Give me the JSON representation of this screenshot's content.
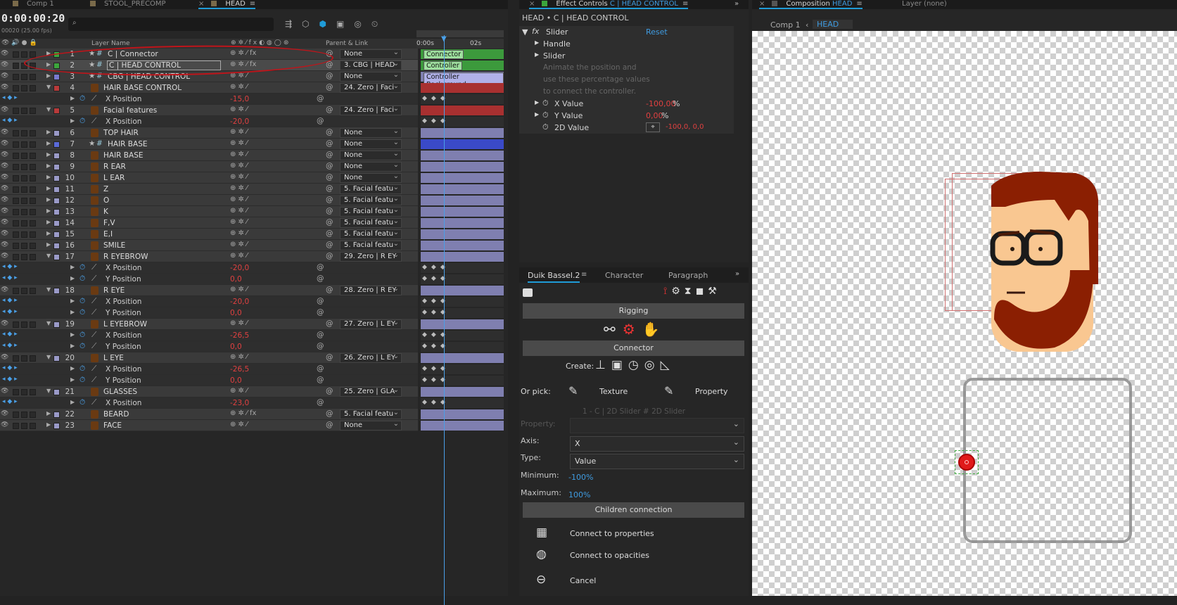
{
  "tabs_left": [
    {
      "label": "Comp 1"
    },
    {
      "label": "STOOL_PRECOMP"
    },
    {
      "label": "HEAD"
    }
  ],
  "tabs_mid": [
    {
      "label": "Effect Controls"
    },
    {
      "label": "C | HEAD CONTROL"
    }
  ],
  "tabs_right": [
    {
      "label": "Composition"
    },
    {
      "label": "HEAD"
    },
    {
      "label": "Layer (none)"
    }
  ],
  "timeline": {
    "timecode": "0:00:00:20",
    "fps": "00020 (25.00 fps)",
    "col_layer_name": "Layer Name",
    "col_parent": "Parent & Link",
    "ruler": [
      "0:00s",
      "02s"
    ],
    "bar_labels": [
      "Connector",
      "Controller",
      "Controller Background"
    ],
    "rows": [
      {
        "t": "layer",
        "num": "1",
        "name": "C | Connector",
        "parent": "None",
        "color": "#3ca63c",
        "star": true,
        "fx": true
      },
      {
        "t": "layer",
        "num": "2",
        "name": "C | HEAD CONTROL",
        "parent": "3. CBG | HEAD",
        "color": "#3ca63c",
        "star": true,
        "fx": true,
        "sel": true
      },
      {
        "t": "layer",
        "num": "3",
        "name": "CBG | HEAD CONTROL",
        "parent": "None",
        "color": "#7a7ad0",
        "star": true
      },
      {
        "t": "layer",
        "num": "4",
        "name": "HAIR BASE CONTROL",
        "parent": "24. Zero | Faci",
        "color": "#b83a3a",
        "open": true
      },
      {
        "t": "prop",
        "name": "X Position",
        "value": "-15,0"
      },
      {
        "t": "layer",
        "num": "5",
        "name": "Facial features",
        "parent": "24. Zero | Faci",
        "color": "#b83a3a",
        "open": true
      },
      {
        "t": "prop",
        "name": "X Position",
        "value": "-20,0"
      },
      {
        "t": "layer",
        "num": "6",
        "name": "TOP HAIR",
        "parent": "None",
        "color": "#9a9ac8"
      },
      {
        "t": "layer",
        "num": "7",
        "name": "HAIR BASE",
        "parent": "None",
        "color": "#5a6ad8",
        "star": true
      },
      {
        "t": "layer",
        "num": "8",
        "name": "HAIR BASE",
        "parent": "None",
        "color": "#9a9ac8"
      },
      {
        "t": "layer",
        "num": "9",
        "name": "R EAR",
        "parent": "None",
        "color": "#9a9ac8"
      },
      {
        "t": "layer",
        "num": "10",
        "name": "L EAR",
        "parent": "None",
        "color": "#9a9ac8"
      },
      {
        "t": "layer",
        "num": "11",
        "name": "Z",
        "parent": "5. Facial featu",
        "color": "#9a9ac8"
      },
      {
        "t": "layer",
        "num": "12",
        "name": "O",
        "parent": "5. Facial featu",
        "color": "#9a9ac8"
      },
      {
        "t": "layer",
        "num": "13",
        "name": "K",
        "parent": "5. Facial featu",
        "color": "#9a9ac8"
      },
      {
        "t": "layer",
        "num": "14",
        "name": "F,V",
        "parent": "5. Facial featu",
        "color": "#9a9ac8"
      },
      {
        "t": "layer",
        "num": "15",
        "name": "E,I",
        "parent": "5. Facial featu",
        "color": "#9a9ac8"
      },
      {
        "t": "layer",
        "num": "16",
        "name": "SMILE",
        "parent": "5. Facial featu",
        "color": "#9a9ac8"
      },
      {
        "t": "layer",
        "num": "17",
        "name": "R EYEBROW",
        "parent": "29. Zero | R EY",
        "color": "#9a9ac8",
        "open": true
      },
      {
        "t": "prop",
        "name": "X Position",
        "value": "-20,0"
      },
      {
        "t": "prop",
        "name": "Y Position",
        "value": "0,0"
      },
      {
        "t": "layer",
        "num": "18",
        "name": "R EYE",
        "parent": "28. Zero | R EY",
        "color": "#9a9ac8",
        "open": true
      },
      {
        "t": "prop",
        "name": "X Position",
        "value": "-20,0"
      },
      {
        "t": "prop",
        "name": "Y Position",
        "value": "0,0"
      },
      {
        "t": "layer",
        "num": "19",
        "name": "L EYEBROW",
        "parent": "27. Zero | L EY",
        "color": "#9a9ac8",
        "open": true
      },
      {
        "t": "prop",
        "name": "X Position",
        "value": "-26,5"
      },
      {
        "t": "prop",
        "name": "Y Position",
        "value": "0,0"
      },
      {
        "t": "layer",
        "num": "20",
        "name": "L EYE",
        "parent": "26. Zero | L EY",
        "color": "#9a9ac8",
        "open": true
      },
      {
        "t": "prop",
        "name": "X Position",
        "value": "-26,5"
      },
      {
        "t": "prop",
        "name": "Y Position",
        "value": "0,0"
      },
      {
        "t": "layer",
        "num": "21",
        "name": "GLASSES",
        "parent": "25. Zero | GLA",
        "color": "#9a9ac8",
        "open": true
      },
      {
        "t": "prop",
        "name": "X Position",
        "value": "-23,0"
      },
      {
        "t": "layer",
        "num": "22",
        "name": "BEARD",
        "parent": "5. Facial featu",
        "color": "#9a9ac8",
        "fx": true
      },
      {
        "t": "layer",
        "num": "23",
        "name": "FACE",
        "parent": "None",
        "color": "#9a9ac8"
      }
    ]
  },
  "effect_controls": {
    "title": "HEAD • C | HEAD CONTROL",
    "effect_name": "Slider",
    "reset": "Reset",
    "handle": "Handle",
    "slider": "Slider",
    "hint": [
      "Animate the position and",
      "use these percentage values",
      "to connect the controller."
    ],
    "x_label": "X Value",
    "x_value": "-100,00",
    "pct": "%",
    "y_label": "Y Value",
    "y_value": "0,00",
    "v2_label": "2D Value",
    "v2_value": "-100,0, 0,0"
  },
  "duik": {
    "tabs": [
      "Duik Bassel.2",
      "Character",
      "Paragraph"
    ],
    "rigging": "Rigging",
    "connector": "Connector",
    "create": "Create:",
    "or_pick": "Or pick:",
    "texture": "Texture",
    "property": "Property",
    "ghost": "1 - C | 2D Slider # 2D Slider",
    "property_label": "Property:",
    "axis_label": "Axis:",
    "axis_value": "X",
    "type_label": "Type:",
    "type_value": "Value",
    "min_label": "Minimum:",
    "min_value": "-100%",
    "max_label": "Maximum:",
    "max_value": "100%",
    "children": "Children connection",
    "connect_props": "Connect to properties",
    "connect_opac": "Connect to opacities",
    "cancel": "Cancel"
  },
  "composition": {
    "breadcrumb_root": "Comp 1",
    "breadcrumb_current": "HEAD"
  },
  "colors": {
    "accent": "#1f9bd7",
    "value_red": "#e04040",
    "selection_red": "#c0141a"
  }
}
